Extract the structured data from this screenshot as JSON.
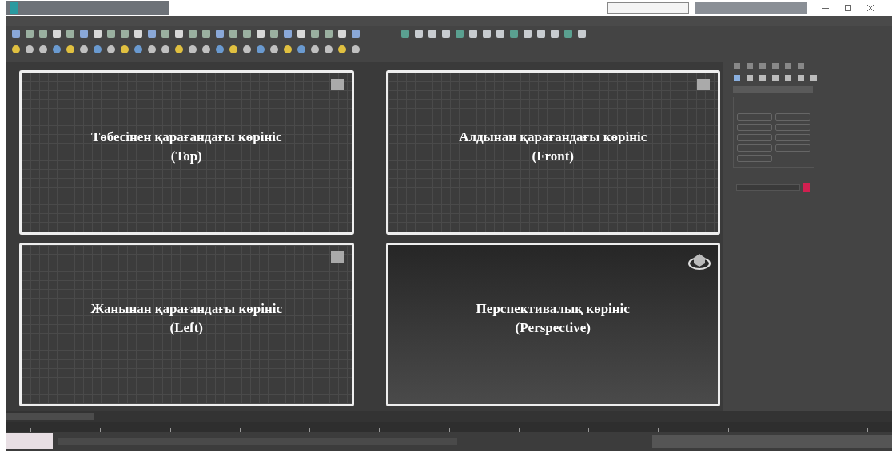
{
  "viewports": [
    {
      "kind": "ortho",
      "caption": "Төбесінен қарағандағы көрініс",
      "view": "(Top)"
    },
    {
      "kind": "ortho",
      "caption": "Алдынан қарағандағы көрініс",
      "view": "(Front)"
    },
    {
      "kind": "ortho",
      "caption": "Жанынан қарағандағы көрініс",
      "view": "(Left)"
    },
    {
      "kind": "perspective",
      "caption": "Перспективалық көрініс",
      "view": "(Perspective)"
    }
  ]
}
